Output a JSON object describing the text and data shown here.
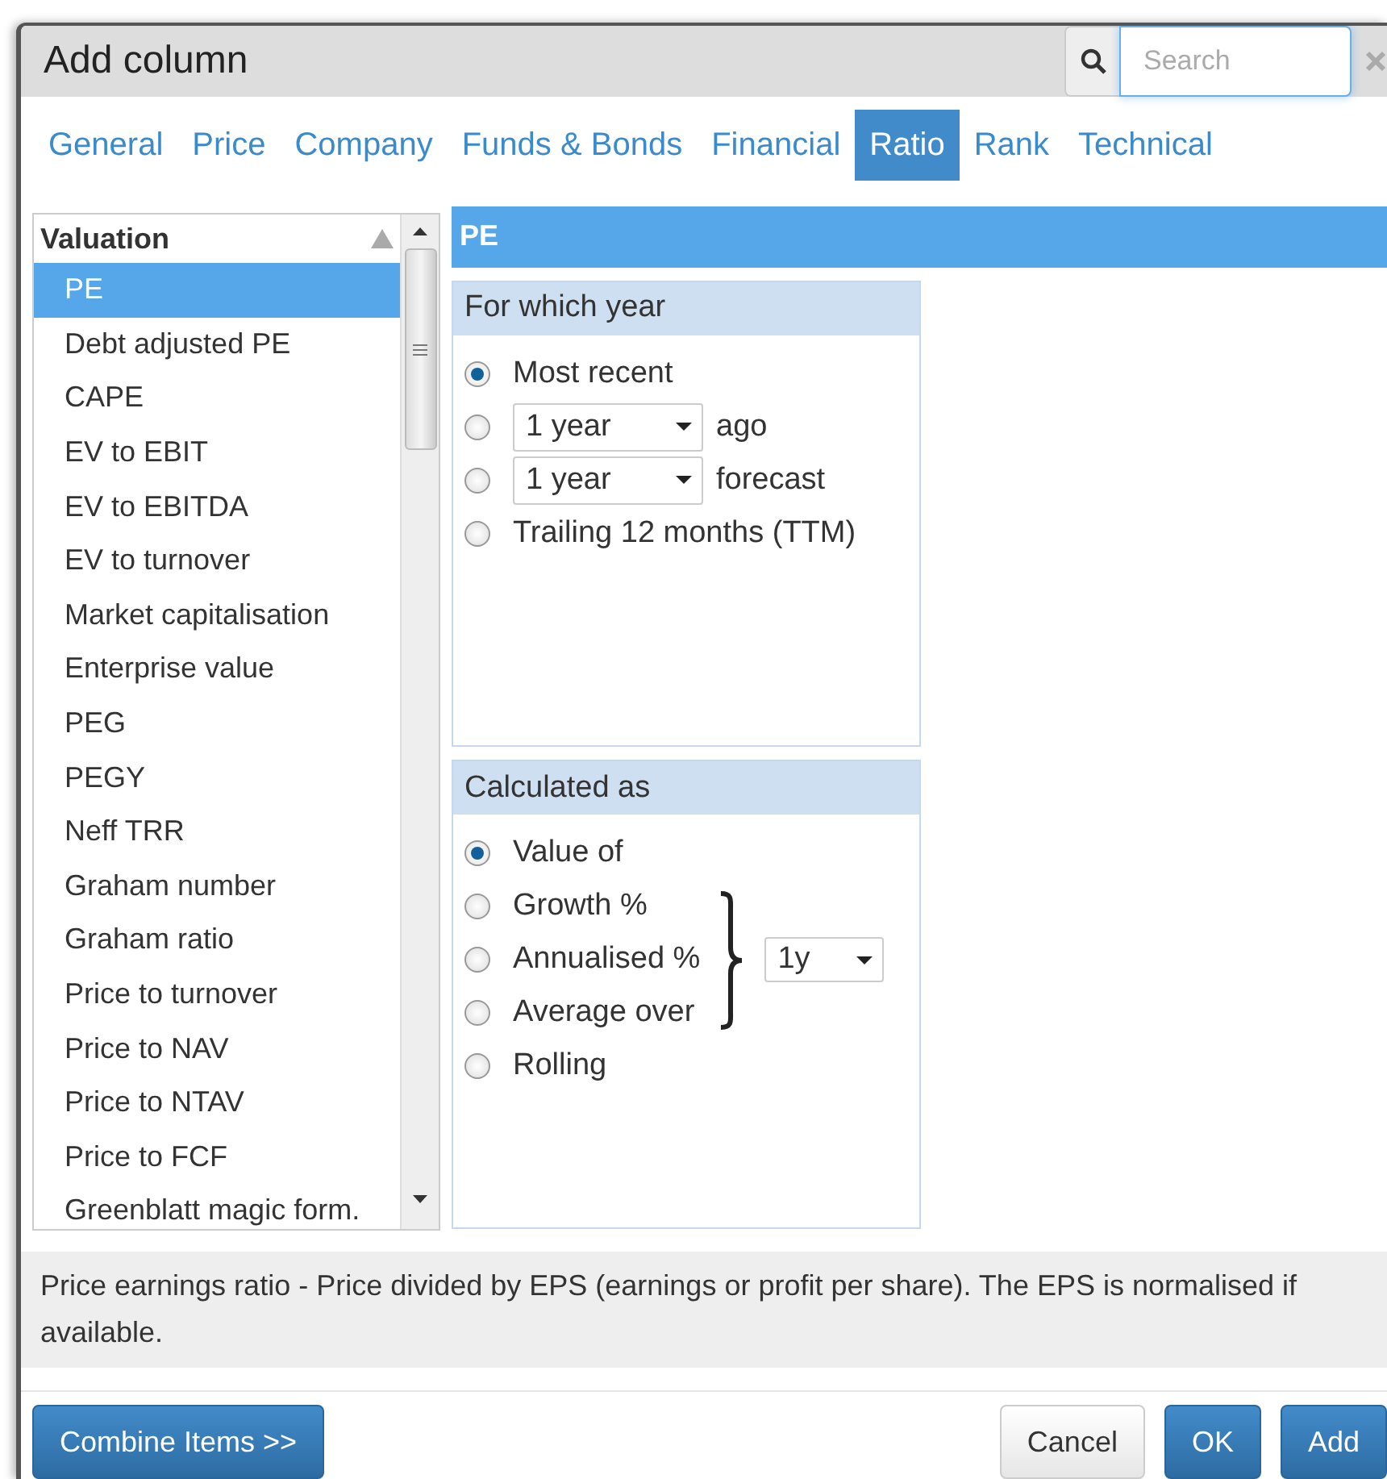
{
  "dialog": {
    "title": "Add column",
    "search": {
      "placeholder": "Search"
    }
  },
  "tabs": [
    {
      "label": "General",
      "selected": false
    },
    {
      "label": "Price",
      "selected": false
    },
    {
      "label": "Company",
      "selected": false
    },
    {
      "label": "Funds & Bonds",
      "selected": false
    },
    {
      "label": "Financial",
      "selected": false
    },
    {
      "label": "Ratio",
      "selected": true
    },
    {
      "label": "Rank",
      "selected": false
    },
    {
      "label": "Technical",
      "selected": false
    }
  ],
  "list": {
    "heading": "Valuation",
    "items": [
      {
        "label": "PE",
        "selected": true
      },
      {
        "label": "Debt adjusted PE",
        "selected": false
      },
      {
        "label": "CAPE",
        "selected": false
      },
      {
        "label": "EV to EBIT",
        "selected": false
      },
      {
        "label": "EV to EBITDA",
        "selected": false
      },
      {
        "label": "EV to turnover",
        "selected": false
      },
      {
        "label": "Market capitalisation",
        "selected": false
      },
      {
        "label": "Enterprise value",
        "selected": false
      },
      {
        "label": "PEG",
        "selected": false
      },
      {
        "label": "PEGY",
        "selected": false
      },
      {
        "label": "Neff TRR",
        "selected": false
      },
      {
        "label": "Graham number",
        "selected": false
      },
      {
        "label": "Graham ratio",
        "selected": false
      },
      {
        "label": "Price to turnover",
        "selected": false
      },
      {
        "label": "Price to NAV",
        "selected": false
      },
      {
        "label": "Price to NTAV",
        "selected": false
      },
      {
        "label": "Price to FCF",
        "selected": false
      },
      {
        "label": "Greenblatt magic form.",
        "selected": false
      }
    ]
  },
  "detail": {
    "title": "PE",
    "year_group": {
      "title": "For which year",
      "options": [
        {
          "kind": "plain",
          "label": "Most recent",
          "selected": true
        },
        {
          "kind": "select",
          "value": "1 year",
          "suffix": "ago",
          "selected": false
        },
        {
          "kind": "select",
          "value": "1 year",
          "suffix": "forecast",
          "selected": false
        },
        {
          "kind": "plain",
          "label": "Trailing 12 months (TTM)",
          "selected": false
        }
      ]
    },
    "calc_group": {
      "title": "Calculated as",
      "rows": [
        {
          "kind": "option",
          "label": "Value of",
          "selected": true
        },
        {
          "kind": "group",
          "period": "1y",
          "options": [
            {
              "label": "Growth %",
              "selected": false
            },
            {
              "label": "Annualised %",
              "selected": false
            },
            {
              "label": "Average over",
              "selected": false
            }
          ]
        },
        {
          "kind": "option",
          "label": "Rolling",
          "selected": false
        }
      ]
    }
  },
  "description": "Price earnings ratio - Price divided by EPS (earnings or profit per share). The EPS is normalised if available.",
  "left_buttons": [
    {
      "label": "Combine Items >>",
      "kind": "primary"
    }
  ],
  "right_buttons": [
    {
      "label": "Cancel",
      "kind": "default"
    },
    {
      "label": "OK",
      "kind": "primary"
    },
    {
      "label": "Add",
      "kind": "primary"
    }
  ]
}
